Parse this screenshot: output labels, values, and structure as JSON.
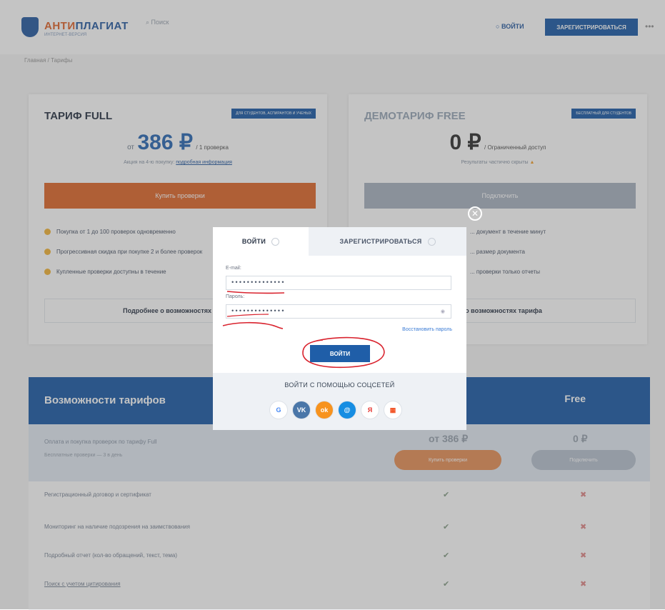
{
  "header": {
    "logo_main": "АНТИ",
    "logo_accent": "ПЛАГИАТ",
    "logo_sub": "ИНТЕРНЕТ-ВЕРСИЯ",
    "search_placeholder": "Поиск",
    "login_link": "ВОЙТИ",
    "register_button": "ЗАРЕГИСТРИРОВАТЬСЯ",
    "more_icon": "ellipsis-icon"
  },
  "breadcrumb": "Главная / Тарифы",
  "plans": {
    "full": {
      "title": "ТАРИФ FULL",
      "badge": "ДЛЯ СТУДЕНТОВ, АСПИРАНТОВ И УЧЕНЫХ",
      "price_prefix": "от",
      "price": "386 ₽",
      "price_note": "/ 1 проверка",
      "sub": "Акция на 4-ю покупку:",
      "sub_link": "подробная информация",
      "button": "Купить проверки",
      "features": [
        "Покупка от 1 до 100 проверок одновременно",
        "Прогрессивная скидка при покупке 2 и более проверок",
        "Купленные проверки доступны в течение"
      ],
      "details": "Подробнее о возможностях тарифа"
    },
    "free": {
      "title": "ДЕМОТАРИФ FREE",
      "badge": "БЕСПЛАТНЫЙ ДЛЯ СТУДЕНТОВ",
      "price": "0 ₽",
      "price_note": "/ Ограниченный доступ",
      "sub": "Результаты частично скрыты",
      "button": "Подключить",
      "features": [
        "... документ в течение минут",
        "... размер документа",
        "... проверки только отчеты"
      ],
      "details": "... о возможностях тарифа"
    }
  },
  "features_table": {
    "title": "Возможности тарифов",
    "col_free": "Free",
    "band_text1": "Оплата и покупка проверок по тарифу Full",
    "band_text2": "Бесплатные проверки — 3 в день",
    "full_price": "от 386 ₽",
    "free_price": "0 ₽",
    "full_button": "Купить проверки",
    "free_button": "Подключить",
    "rows": [
      {
        "label": "Регистрационный договор и сертификат"
      },
      {
        "label": "Мониторинг на наличие подозрения на заимствования"
      },
      {
        "label": "Подробный отчет (кол-во обращений, текст, тема)"
      },
      {
        "label": "Поиск с учетом цитирования"
      }
    ],
    "check_icon": "check-icon",
    "cross_icon": "cross-icon"
  },
  "modal": {
    "close_icon": "close-icon",
    "tab_login": "ВОЙТИ",
    "tab_register": "ЗАРЕГИСТРИРОВАТЬСЯ",
    "email_label": "E-mail:",
    "email_value": "••••••••••••••",
    "password_label": "Пароль:",
    "password_value": "••••••••••••••",
    "show_password_icon": "eye-icon",
    "forgot_link": "Восстановить пароль",
    "submit": "ВОЙТИ",
    "social_title": "ВОЙТИ С ПОМОЩЬЮ СОЦСЕТЕЙ",
    "social": [
      {
        "name": "google-icon",
        "glyph": "G",
        "color": "#ffffff",
        "fg": "#4285f4"
      },
      {
        "name": "vk-icon",
        "glyph": "VK",
        "color": "#4a76a8",
        "fg": "#ffffff"
      },
      {
        "name": "odnoklassniki-icon",
        "glyph": "ok",
        "color": "#f7931e",
        "fg": "#ffffff"
      },
      {
        "name": "mailru-icon",
        "glyph": "@",
        "color": "#168de2",
        "fg": "#ffffff"
      },
      {
        "name": "yandex-icon",
        "glyph": "Я",
        "color": "#ffffff",
        "fg": "#e5322d"
      },
      {
        "name": "microsoft-icon",
        "glyph": "▦",
        "color": "#ffffff",
        "fg": "#f25022"
      }
    ]
  },
  "colors": {
    "brand_blue": "#1f5ea8",
    "brand_orange": "#e06a2e",
    "annotation_red": "#d9232e"
  }
}
